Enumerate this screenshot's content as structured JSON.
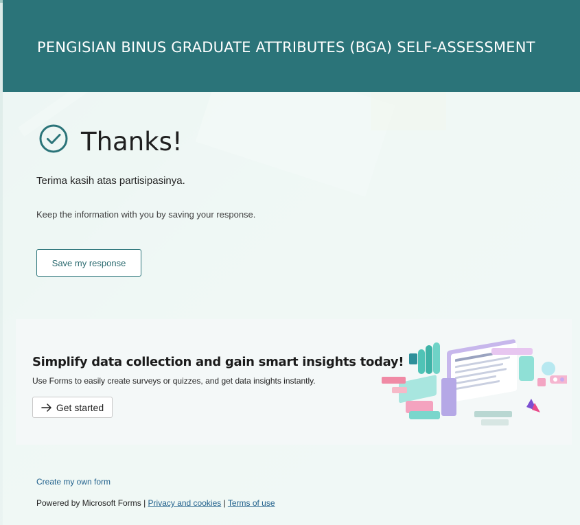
{
  "header": {
    "title": "PENGISIAN BINUS GRADUATE ATTRIBUTES (BGA) SELF-ASSESSMENT",
    "color": "#2b7479"
  },
  "confirmation": {
    "icon": "check-circle-icon",
    "heading": "Thanks!",
    "message": "Terima kasih atas partisipasinya.",
    "keep_info": "Keep the information with you by saving your response.",
    "save_button": "Save my response"
  },
  "promo": {
    "title": "Simplify data collection and gain smart insights today!",
    "subtitle": "Use Forms to easily create surveys or quizzes, and get data insights instantly.",
    "button_icon": "arrow-right-icon",
    "button_label": "Get started",
    "illustration_icon": "forms-illustration"
  },
  "footer": {
    "create_link": "Create my own form",
    "powered_by": "Powered by Microsoft Forms",
    "separator": "|",
    "privacy_link": "Privacy and cookies",
    "terms_link": "Terms of use"
  }
}
